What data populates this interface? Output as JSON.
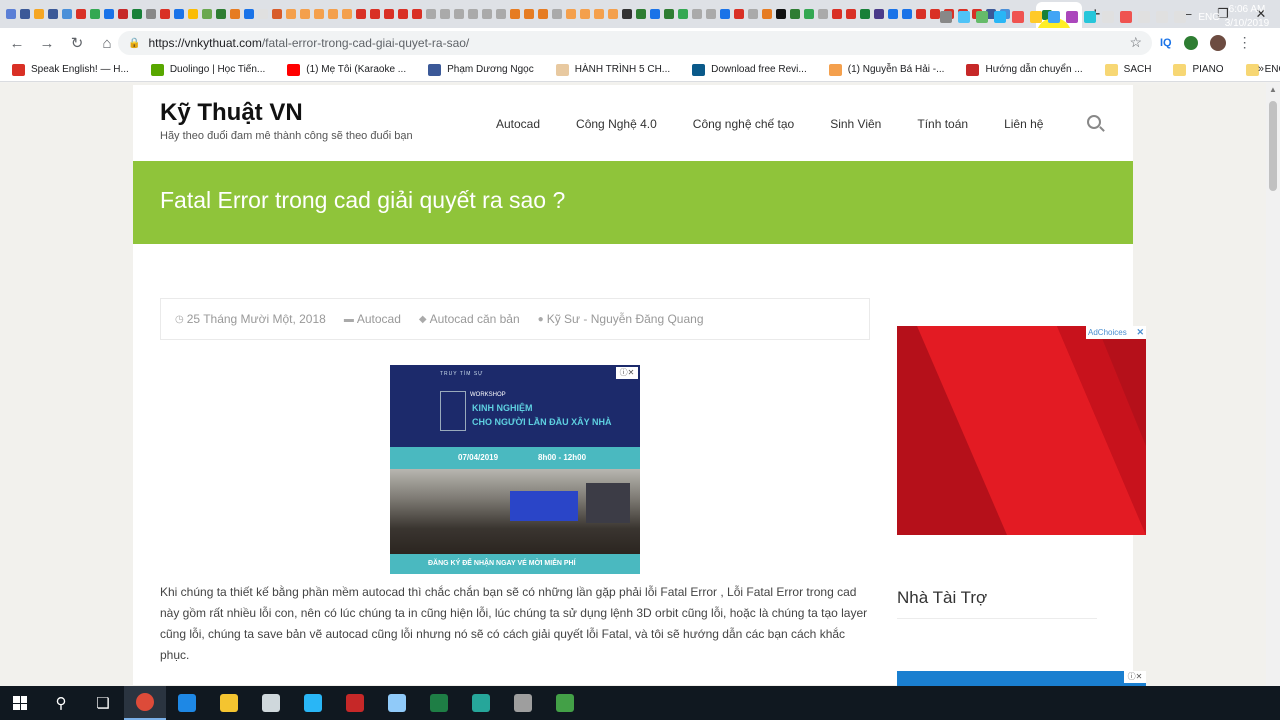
{
  "browser": {
    "favicon_colors": [
      "#5b7fd6",
      "#3b5998",
      "#f5a623",
      "#3b5998",
      "#4a90d9",
      "#d93025",
      "#34a853",
      "#1a73e8",
      "#c62828",
      "#188038",
      "#888888",
      "#d93025",
      "#1a73e8",
      "#fbbc04",
      "#6aa84f",
      "#2e7d32",
      "#e67c22",
      "#1a73e8",
      "#e0e0e0",
      "#d85c2a",
      "#f4a04d",
      "#f4a04d",
      "#f4a04d",
      "#f4a04d",
      "#f4a04d",
      "#d93025",
      "#d93025",
      "#d93025",
      "#d93025",
      "#d93025",
      "#aaaaaa",
      "#aaaaaa",
      "#aaaaaa",
      "#aaaaaa",
      "#aaaaaa",
      "#aaaaaa",
      "#e67c22",
      "#e67c22",
      "#e67c22",
      "#aaaaaa",
      "#f4a04d",
      "#f4a04d",
      "#f4a04d",
      "#f4a04d",
      "#333333",
      "#2e7d32",
      "#1a73e8",
      "#2e7d32",
      "#34a853",
      "#aaaaaa",
      "#aaaaaa",
      "#1a73e8",
      "#d93025",
      "#aaaaaa",
      "#e67c22",
      "#111111",
      "#2e7d32",
      "#34a853",
      "#aaaaaa",
      "#d93025",
      "#d93025",
      "#188038",
      "#4a3a8a",
      "#1a73e8",
      "#1a73e8",
      "#d93025",
      "#d93025",
      "#d93025",
      "#d93025",
      "#d93025",
      "#3b5998",
      "#4a90d9"
    ],
    "active_tab": {
      "favicon_color": "#188038",
      "close_glyph": "✕"
    },
    "new_tab_glyph": "+",
    "window_controls": {
      "minimize": "—",
      "maximize": "❐",
      "close": "✕"
    },
    "url_host": "https://vnkythuat.com",
    "url_path": "/fatal-error-trong-cad-giai-quyet-ra-sao/",
    "extensions": {
      "iq_label": "IQ"
    },
    "bookmarks": [
      {
        "label": "Speak English! — H...",
        "color": "#d93025"
      },
      {
        "label": "Duolingo | Học Tiến...",
        "color": "#58a700"
      },
      {
        "label": "(1) Mẹ Tôi (Karaoke ...",
        "color": "#ff0000"
      },
      {
        "label": "Phạm Dương Ngọc",
        "color": "#3b5998"
      },
      {
        "label": "HÀNH TRÌNH 5 CH...",
        "color": "#e8c9a0"
      },
      {
        "label": "Download free Revi...",
        "color": "#0a5a8a"
      },
      {
        "label": "(1) Nguyễn Bá Hải -...",
        "color": "#f4a04d"
      },
      {
        "label": "Hướng dẫn chuyển ...",
        "color": "#c62828"
      },
      {
        "label": "SACH",
        "color": "#f7d774"
      },
      {
        "label": "PIANO",
        "color": "#f7d774"
      },
      {
        "label": "ENGLISH",
        "color": "#f7d774"
      }
    ],
    "bookmarks_more": "»"
  },
  "site": {
    "title": "Kỹ Thuật VN",
    "tagline": "Hãy theo đuổi đam mê thành công sẽ theo đuổi bạn",
    "nav": [
      "Autocad",
      "Công Nghệ 4.0",
      "Công nghệ chế tạo",
      "Sinh Viên",
      "Tính toán",
      "Liên hệ"
    ],
    "accent": "#8fc43a"
  },
  "article": {
    "title": "Fatal Error trong cad giải quyết ra sao ?",
    "meta": {
      "date": "25 Tháng Mười Một, 2018",
      "category": "Autocad",
      "tag": "Autocad căn bản",
      "author": "Kỹ Sư - Nguyễn Đăng Quang"
    },
    "body": "Khi chúng ta thiết kế bằng phần mềm autocad thì chắc chắn bạn sẽ có những lần gặp phải lỗi Fatal Error , Lỗi Fatal Error trong cad này gồm rất nhiều lỗi con, nên có lúc chúng ta in cũng hiện lỗi, lúc chúng ta sử dụng lệnh 3D orbit cũng lỗi, hoặc là chúng ta tạo layer cũng lỗi, chúng ta save bản vẽ autocad cũng lỗi nhưng nó sẽ có cách giải quyết lỗi Fatal, và tôi sẽ hướng dẫn các bạn cách khắc phục."
  },
  "ad_main": {
    "brand": "TRUY TÌM SỰ",
    "workshop": "WORKSHOP",
    "headline1": "KINH NGHIỆM",
    "headline2": "CHO NGƯỜI LẦN ĐẦU XÂY NHÀ",
    "date": "07/04/2019",
    "time": "8h00 - 12h00",
    "cta": "ĐĂNG KÝ ĐỂ NHẬN NGAY VÉ MỜI MIỄN PHÍ",
    "close_glyph": "ⓘ✕"
  },
  "sidebar": {
    "adchoices": "AdChoices",
    "adchoices_close": "✕",
    "sponsor_title": "Nhà Tài Trợ",
    "ad2_close": "ⓘ✕"
  },
  "taskbar": {
    "apps": [
      {
        "name": "search",
        "color": "#101820",
        "glyph": "⚲"
      },
      {
        "name": "task-view",
        "color": "#101820",
        "glyph": "❏"
      },
      {
        "name": "chrome",
        "color": "#dd4b39"
      },
      {
        "name": "edge",
        "color": "#1e88e5"
      },
      {
        "name": "explorer",
        "color": "#f4c430"
      },
      {
        "name": "app",
        "color": "#cfd8dc"
      },
      {
        "name": "app",
        "color": "#29b6f6"
      },
      {
        "name": "autocad",
        "color": "#c62828"
      },
      {
        "name": "app",
        "color": "#90caf9"
      },
      {
        "name": "excel",
        "color": "#1e7e45"
      },
      {
        "name": "app",
        "color": "#26a69a"
      },
      {
        "name": "app",
        "color": "#9e9e9e"
      },
      {
        "name": "app",
        "color": "#43a047"
      }
    ],
    "tray_colors": [
      "#888888",
      "#4fc3f7",
      "#66bb6a",
      "#29b6f6",
      "#ef5350",
      "#ffca28",
      "#42a5f5",
      "#ab47bc",
      "#26c6da",
      "#e0e0e0",
      "#ef5350",
      "#e0e0e0",
      "#e0e0e0",
      "#e0e0e0"
    ],
    "language": "ENG",
    "time": "6:06 AM",
    "date": "3/10/2019"
  }
}
